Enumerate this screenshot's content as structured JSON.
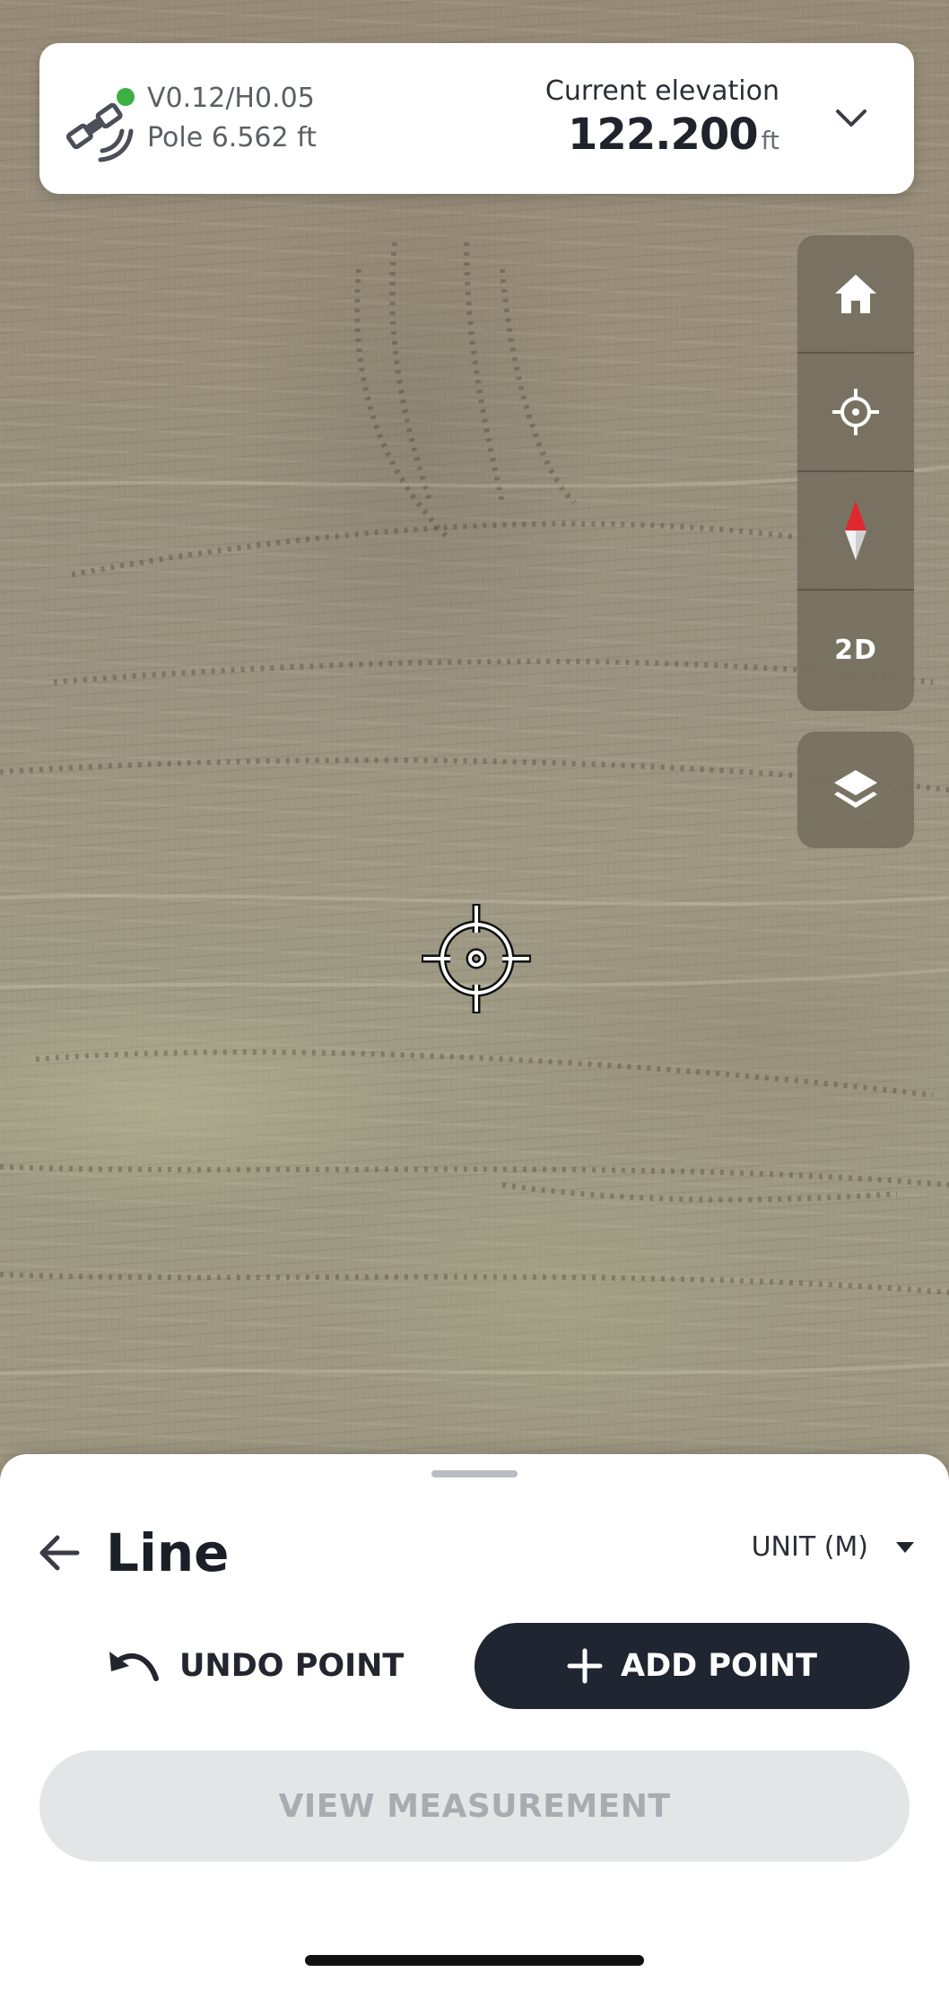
{
  "status": {
    "accuracy": "V0.12/H0.05",
    "pole": "Pole 6.562 ft",
    "elevation_label": "Current elevation",
    "elevation_value": "122.200",
    "elevation_unit": "ft",
    "connection_color": "#3cb043"
  },
  "map_controls": {
    "home_icon": "home-icon",
    "locate_icon": "locate-crosshair-icon",
    "compass_icon": "compass-icon",
    "view_mode_label": "2D",
    "layers_icon": "layers-icon"
  },
  "sheet": {
    "title": "Line",
    "unit_label": "UNIT (M)",
    "undo_label": "UNDO POINT",
    "add_label": "ADD POINT",
    "view_label": "VIEW MEASUREMENT"
  },
  "colors": {
    "primary_button": "#1f2631",
    "disabled_button": "#e4e5e7",
    "compass_red": "#e0282e"
  }
}
